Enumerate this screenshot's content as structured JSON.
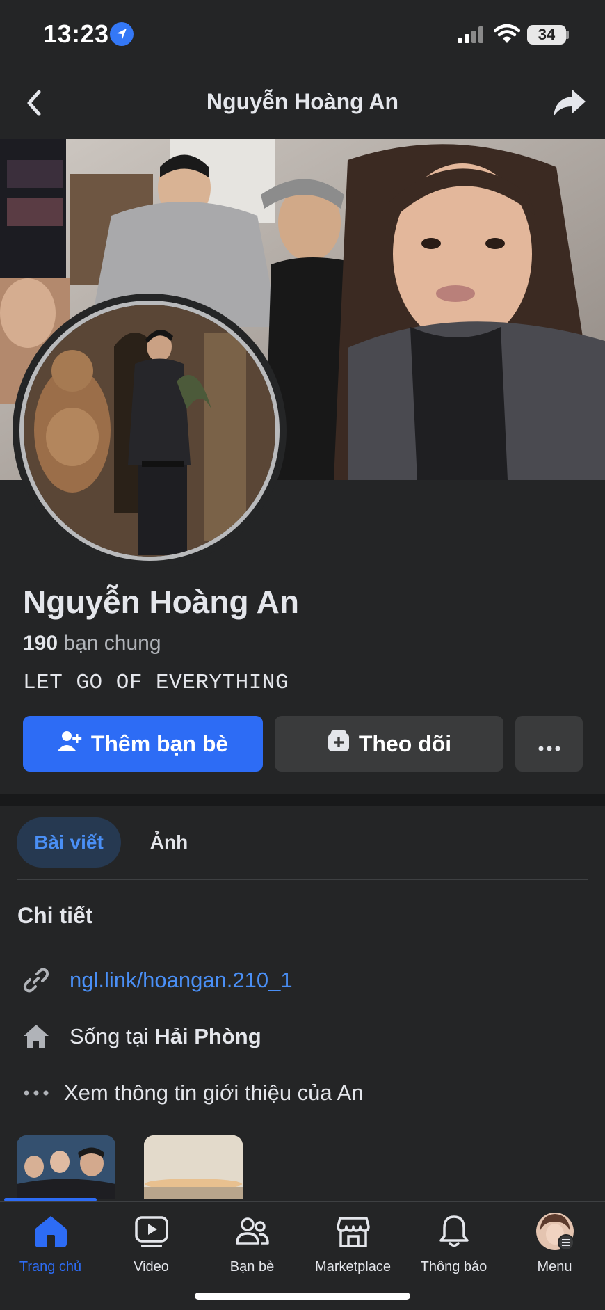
{
  "status_bar": {
    "time": "13:23",
    "battery": "34"
  },
  "header": {
    "title": "Nguyễn Hoàng An"
  },
  "profile": {
    "name": "Nguyễn Hoàng An",
    "mutual_count": "190",
    "mutual_label": "bạn chung",
    "bio": "LET GO OF EVERYTHING"
  },
  "actions": {
    "add_friend": "Thêm bạn bè",
    "follow": "Theo dõi"
  },
  "tabs": [
    {
      "label": "Bài viết",
      "active": true
    },
    {
      "label": "Ảnh",
      "active": false
    }
  ],
  "details": {
    "title": "Chi tiết",
    "link": "ngl.link/hoangan.210_1",
    "lives_prefix": "Sống tại",
    "lives_city": "Hải Phòng",
    "see_about": "Xem thông tin giới thiệu của An"
  },
  "bottom_nav": [
    {
      "label": "Trang chủ",
      "icon": "home-icon",
      "active": true
    },
    {
      "label": "Video",
      "icon": "video-icon",
      "active": false
    },
    {
      "label": "Bạn bè",
      "icon": "friends-icon",
      "active": false
    },
    {
      "label": "Marketplace",
      "icon": "marketplace-icon",
      "active": false
    },
    {
      "label": "Thông báo",
      "icon": "bell-icon",
      "active": false
    },
    {
      "label": "Menu",
      "icon": "menu-avatar-icon",
      "active": false
    }
  ],
  "colors": {
    "background": "#242526",
    "accent": "#2d6cf5",
    "link": "#4a8ff5",
    "secondary_button": "#3a3b3c"
  }
}
